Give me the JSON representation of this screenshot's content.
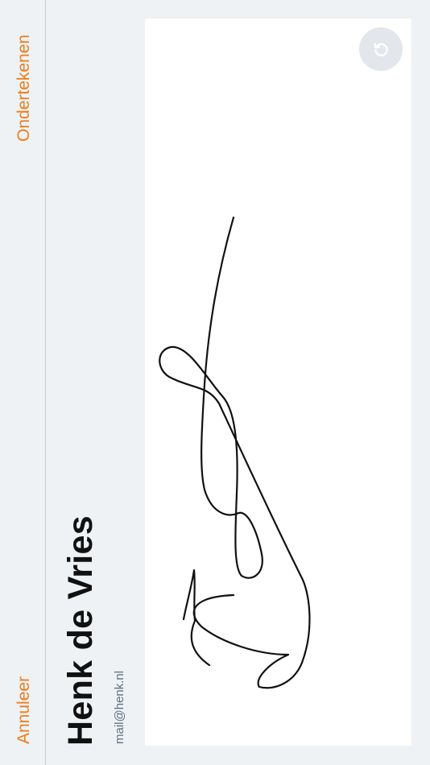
{
  "actions": {
    "cancel_label": "Annuleer",
    "sign_label": "Ondertekenen"
  },
  "signer": {
    "name": "Henk de Vries",
    "email": "mail@henk.nl"
  },
  "signature_pad": {
    "reset_icon": "reset-icon"
  },
  "colors": {
    "accent": "#f07c18",
    "background": "#eef2f5",
    "pad": "#ffffff"
  }
}
